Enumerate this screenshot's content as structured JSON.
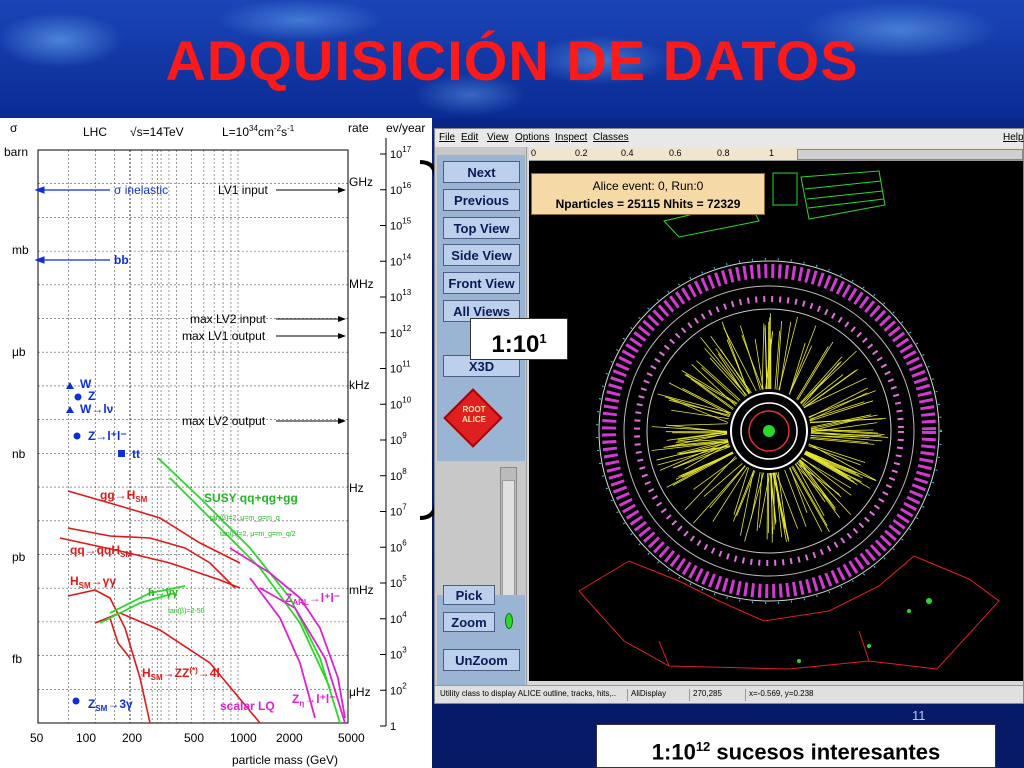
{
  "slide": {
    "title": "ADQUISICIÓN DE DATOS",
    "page_number": "11",
    "ratio_label": {
      "base": "1:10",
      "exp": "1"
    },
    "bottom_label": {
      "base": "1:10",
      "exp": "12",
      "text": " sucesos interesantes"
    }
  },
  "plot": {
    "header": {
      "sigma": "σ",
      "barn": "barn",
      "lhc": "LHC",
      "energy": "√s=14TeV",
      "lumi_base": "L=10",
      "lumi_exp": "34",
      "lumi_unit": "cm",
      "lumi_unit_exp": "-2",
      "lumi_s": "s",
      "lumi_s_exp": "-1",
      "rate": "rate",
      "evyear": "ev/year"
    },
    "y_labels_left": [
      "mb",
      "μb",
      "nb",
      "pb",
      "fb"
    ],
    "y_labels_rate": [
      "GHz",
      "MHz",
      "kHz",
      "Hz",
      "mHz",
      "μHz"
    ],
    "ev_exponents": [
      "17",
      "16",
      "15",
      "14",
      "13",
      "12",
      "11",
      "10",
      "9",
      "8",
      "7",
      "6",
      "5",
      "4",
      "3",
      "2",
      "1"
    ],
    "x_ticks": [
      "50",
      "100",
      "200",
      "500",
      "1000",
      "2000",
      "5000"
    ],
    "x_label": "particle mass (GeV)",
    "processes": {
      "inelastic": "σ inelastic",
      "bb": "bb",
      "w": "W",
      "z": "Z",
      "w_lnu": "W→lν",
      "z_ll": "Z→l⁺l⁻",
      "tt": "tt",
      "gg_h": "gg→H",
      "gg_h_sub": "SM",
      "qq_qqh": "qq→qqH",
      "qq_qqh_sub": "SM",
      "h_gg": "H",
      "h_gg_sub": "SM",
      "h_gg_tail": "→γγ",
      "h_zz": "H",
      "h_zz_sub": "SM",
      "h_zz_tail": "→ZZ",
      "h_zz_sup": "(*)",
      "h_zz_end": "→4l",
      "h_ggamma": "h→γγ",
      "susy": "SUSY qq+qg+gg",
      "scalar_lq": "scalar LQ",
      "z_arl": "Z",
      "z_arl_sub": "ARL",
      "z_arl_tail": "→l⁺l⁻",
      "zeta": "Z",
      "zeta_sub": "η",
      "zeta_tail": "→l⁺l⁻",
      "z_3g": "Z",
      "z_3g_sub": "SM",
      "z_3g_tail": "→3γ",
      "tanb": "tan(β)=2-50",
      "susy_small_1": "tan(β)=2, μ=m_g=m_q",
      "susy_small_2": "tan(β)=2, μ=m_g=m_q/2"
    },
    "triggers": {
      "lv1_input": "LV1 input",
      "max_lv2_input": "max LV2 input",
      "max_lv1_output": "max LV1 output",
      "max_lv2_output": "max LV2 output"
    }
  },
  "app": {
    "menu": [
      "File",
      "Edit",
      "View",
      "Options",
      "Inspect",
      "Classes"
    ],
    "help": "Help",
    "buttons": {
      "next": "Next",
      "previous": "Previous",
      "top_view": "Top View",
      "side_view": "Side View",
      "front_view": "Front View",
      "all_views": "All Views",
      "x3d": "X3D",
      "pick": "Pick",
      "zoom": "Zoom",
      "unzoom": "UnZoom"
    },
    "root_label_top": "ROOT",
    "root_label_bottom": "ALICE",
    "ruler_ticks": [
      "0",
      "0.2",
      "0.4",
      "0.6",
      "0.8",
      "1"
    ],
    "event_line1": "Alice event: 0, Run:0",
    "event_line2": "Nparticles = 25115  Nhits = 72329",
    "status": {
      "hint": "Utility class to display ALICE outline, tracks, hits,..",
      "classname": "AliDisplay",
      "pixel": "270,285",
      "coords": "x=-0.569, y=0.238"
    }
  }
}
